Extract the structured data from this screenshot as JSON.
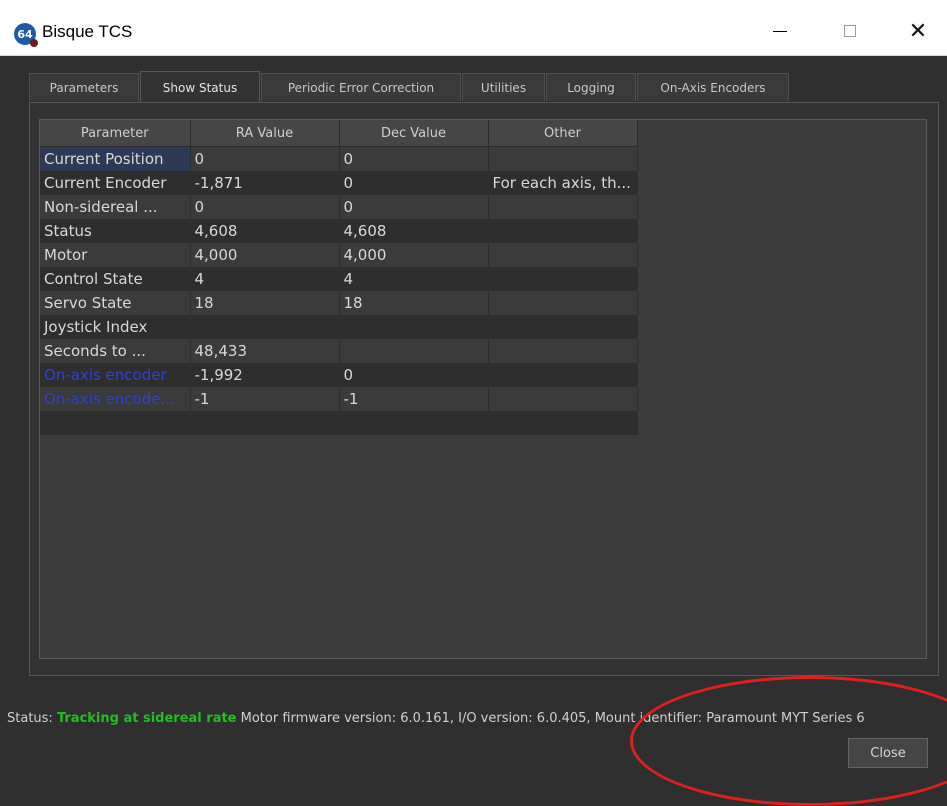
{
  "window": {
    "icon_text": "64",
    "title": "Bisque TCS",
    "minimize_glyph": "—",
    "maximize_glyph": "□",
    "close_glyph": "✕"
  },
  "tabs": [
    {
      "label": "Parameters"
    },
    {
      "label": "Show Status",
      "active": true
    },
    {
      "label": "Periodic Error Correction"
    },
    {
      "label": "Utilities"
    },
    {
      "label": "Logging"
    },
    {
      "label": "On-Axis Encoders"
    }
  ],
  "table": {
    "headers": [
      "Parameter",
      "RA Value",
      "Dec Value",
      "Other"
    ],
    "rows": [
      {
        "param": "Current Position",
        "ra": "0",
        "dec": "0",
        "other": ""
      },
      {
        "param": "Current Encoder",
        "ra": "-1,871",
        "dec": "0",
        "other": "For each axis, th..."
      },
      {
        "param": "Non-sidereal ...",
        "ra": "0",
        "dec": "0",
        "other": ""
      },
      {
        "param": "Status",
        "ra": "4,608",
        "dec": "4,608",
        "other": ""
      },
      {
        "param": "Motor",
        "ra": "4,000",
        "dec": "4,000",
        "other": ""
      },
      {
        "param": "Control State",
        "ra": "4",
        "dec": "4",
        "other": ""
      },
      {
        "param": "Servo State",
        "ra": "18",
        "dec": "18",
        "other": ""
      },
      {
        "param": "Joystick Index",
        "ra": "",
        "dec": "",
        "other": ""
      },
      {
        "param": "Seconds to ...",
        "ra": "48,433",
        "dec": "",
        "other": ""
      },
      {
        "param": "On-axis encoder",
        "ra": "-1,992",
        "dec": "0",
        "other": ""
      },
      {
        "param": "On-axis encode...",
        "ra": "-1",
        "dec": "-1",
        "other": ""
      },
      {
        "param": "",
        "ra": "",
        "dec": "",
        "other": ""
      }
    ]
  },
  "status_bar": {
    "label": "Status:",
    "tracking": "Tracking at sidereal rate",
    "details": "Motor firmware version: 6.0.161, I/O version: 6.0.405, Mount identifier: Paramount MYT Series 6"
  },
  "buttons": {
    "close": "Close"
  },
  "colors": {
    "tracking_green": "#1ec21e",
    "encoder_blue": "#3040d8",
    "highlight_red": "#e0201c"
  }
}
